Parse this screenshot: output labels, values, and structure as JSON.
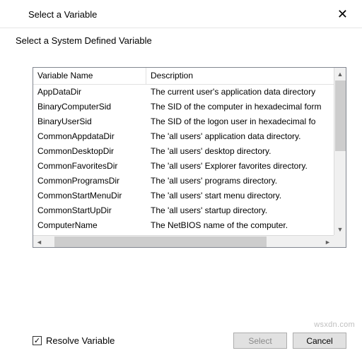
{
  "dialog": {
    "title": "Select a Variable",
    "subheading": "Select a System Defined Variable",
    "close_glyph": "✕"
  },
  "table": {
    "columns": {
      "name": "Variable Name",
      "desc": "Description"
    },
    "rows": [
      {
        "name": "AppDataDir",
        "desc": "The current user's application data directory"
      },
      {
        "name": "BinaryComputerSid",
        "desc": "The SID of the computer in hexadecimal form"
      },
      {
        "name": "BinaryUserSid",
        "desc": "The SID of the logon user in hexadecimal fo"
      },
      {
        "name": "CommonAppdataDir",
        "desc": "The 'all users' application data directory."
      },
      {
        "name": "CommonDesktopDir",
        "desc": "The 'all users' desktop directory."
      },
      {
        "name": "CommonFavoritesDir",
        "desc": "The 'all users' Explorer favorites directory."
      },
      {
        "name": "CommonProgramsDir",
        "desc": "The 'all users' programs directory."
      },
      {
        "name": "CommonStartMenuDir",
        "desc": "The 'all users' start menu directory."
      },
      {
        "name": "CommonStartUpDir",
        "desc": "The 'all users' startup directory."
      },
      {
        "name": "ComputerName",
        "desc": "The NetBIOS name of the computer."
      }
    ]
  },
  "footer": {
    "checkbox_label": "Resolve Variable",
    "checkbox_checked_glyph": "✓",
    "select_label": "Select",
    "cancel_label": "Cancel"
  },
  "watermark": "wsxdn.com"
}
